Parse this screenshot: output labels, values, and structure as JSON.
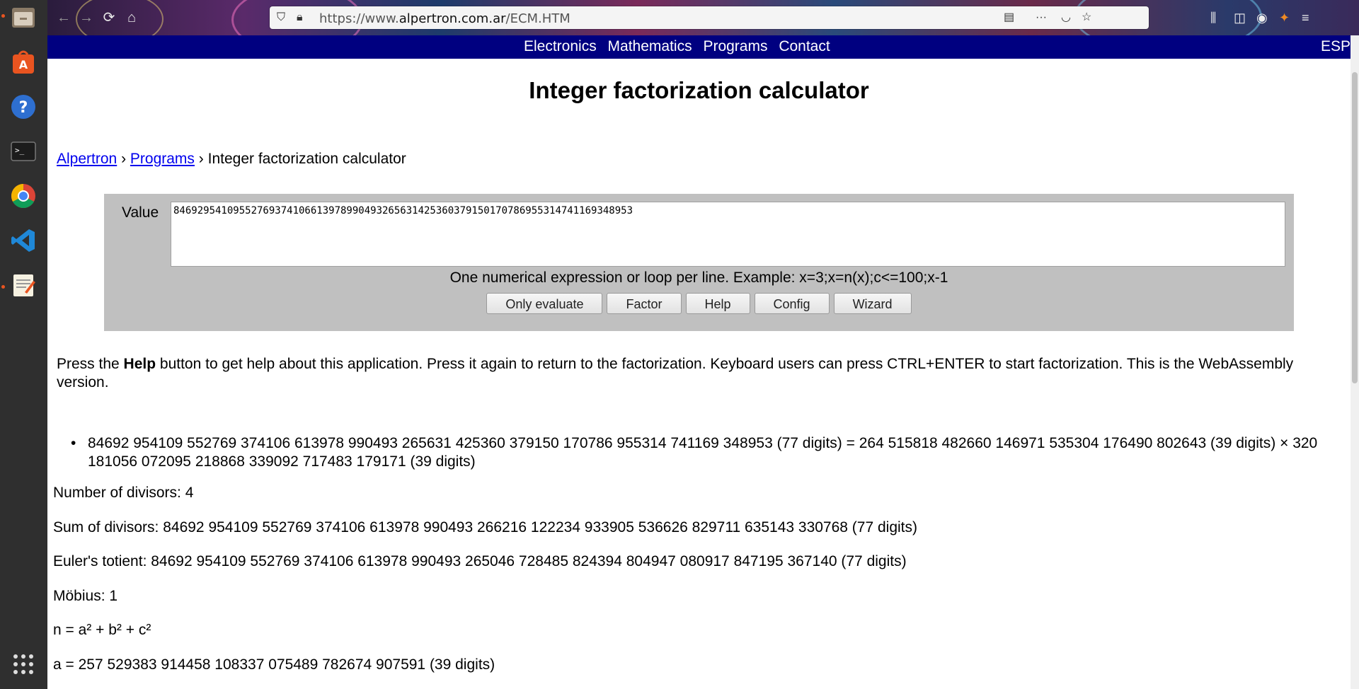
{
  "dock": {
    "apps": [
      "files-icon",
      "software-center-icon",
      "help-icon",
      "terminal-icon",
      "chrome-icon",
      "vscode-icon",
      "text-editor-icon"
    ],
    "grid": "show-applications-icon"
  },
  "browser": {
    "url_prefix": "https://www.",
    "url_domain": "alpertron.com.ar",
    "url_path": "/ECM.HTM"
  },
  "nav": {
    "links": [
      "Electronics",
      "Mathematics",
      "Programs",
      "Contact"
    ],
    "lang": "ESP"
  },
  "page": {
    "title": "Integer factorization calculator",
    "breadcrumb": {
      "home": "Alpertron",
      "sep": "›",
      "programs": "Programs",
      "current": "Integer factorization calculator"
    }
  },
  "calc": {
    "value_label": "Value",
    "value": "84692954109552769374106613978990493265631425360379150170786955314741169348953",
    "hint": "One numerical expression or loop per line. Example: x=3;x=n(x);c<=100;x-1",
    "buttons": [
      "Only evaluate",
      "Factor",
      "Help",
      "Config",
      "Wizard"
    ]
  },
  "help": {
    "pre": "Press the ",
    "bold": "Help",
    "post": " button to get help about this application. Press it again to return to the factorization. Keyboard users can press CTRL+ENTER to start factorization. This is the WebAssembly version."
  },
  "results": {
    "factorization": "84692 954109 552769 374106 613978 990493 265631 425360 379150 170786 955314 741169 348953 (77 digits) = 264 515818 482660 146971 535304 176490 802643 (39 digits) × 320 181056 072095 218868 339092 717483 179171 (39 digits)",
    "divisors": "Number of divisors: 4",
    "sum_divisors": "Sum of divisors: 84692 954109 552769 374106 613978 990493 266216 122234 933905 536626 829711 635143 330768 (77 digits)",
    "totient": "Euler's totient: 84692 954109 552769 374106 613978 990493 265046 728485 824394 804947 080917 847195 367140 (77 digits)",
    "mobius": "Möbius: 1",
    "squares": "n = a² + b² + c²",
    "a": "a = 257 529383 914458 108337 075489 782674 907591 (39 digits)"
  }
}
